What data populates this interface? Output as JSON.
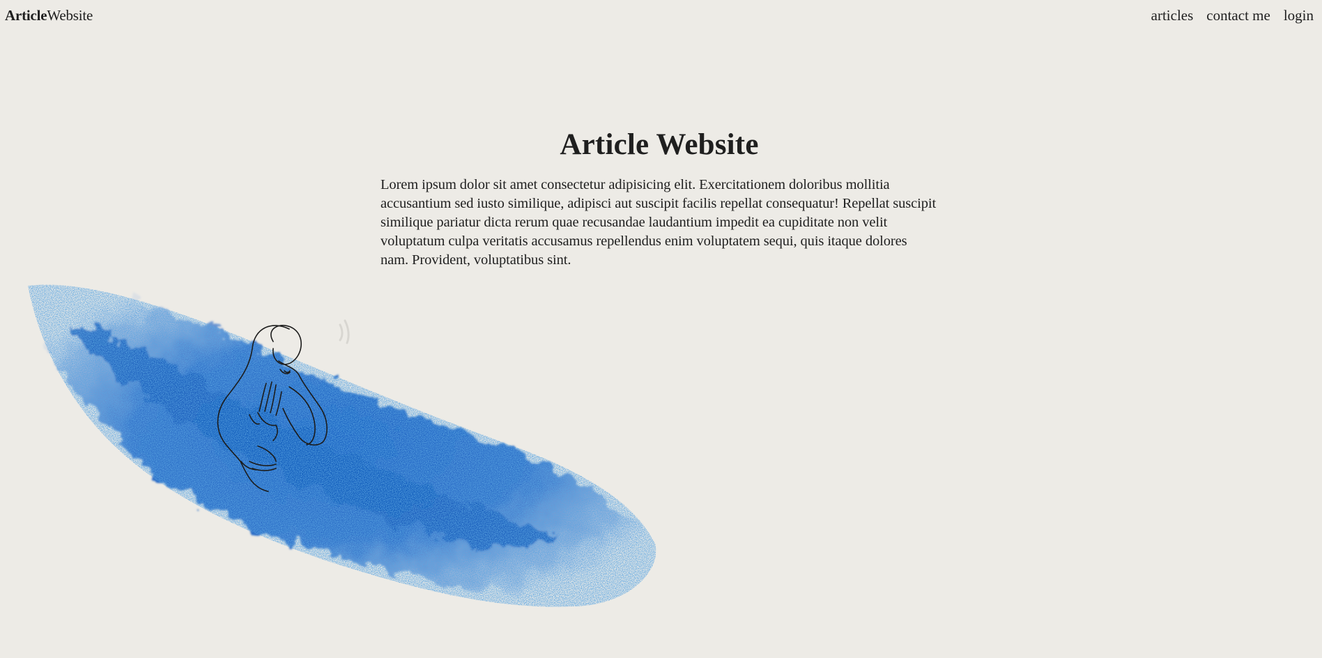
{
  "header": {
    "logo_bold": "Article",
    "logo_regular": "Website",
    "nav": [
      {
        "label": "articles"
      },
      {
        "label": "contact me"
      },
      {
        "label": "login"
      }
    ]
  },
  "hero": {
    "title": "Article Website",
    "body": "Lorem ipsum dolor sit amet consectetur adipisicing elit. Exercitationem doloribus mollitia accusantium sed iusto similique, adipisci aut suscipit facilis repellat consequatur! Repellat suscipit similique pariatur dicta rerum quae recusandae laudantium impedit ea cupiditate non velit voluptatum culpa veritatis accusamus repellendus enim voluptatem sequi, quis itaque dolores nam. Provident, voluptatibus sint."
  },
  "illustration": {
    "name": "blue-watercolor-line-art-figure",
    "brush_color": "#1a5fc0",
    "line_color": "#1c1c1c"
  },
  "colors": {
    "background": "#edebe6",
    "text": "#1f1f1f",
    "accent": "#1a5fc0"
  }
}
